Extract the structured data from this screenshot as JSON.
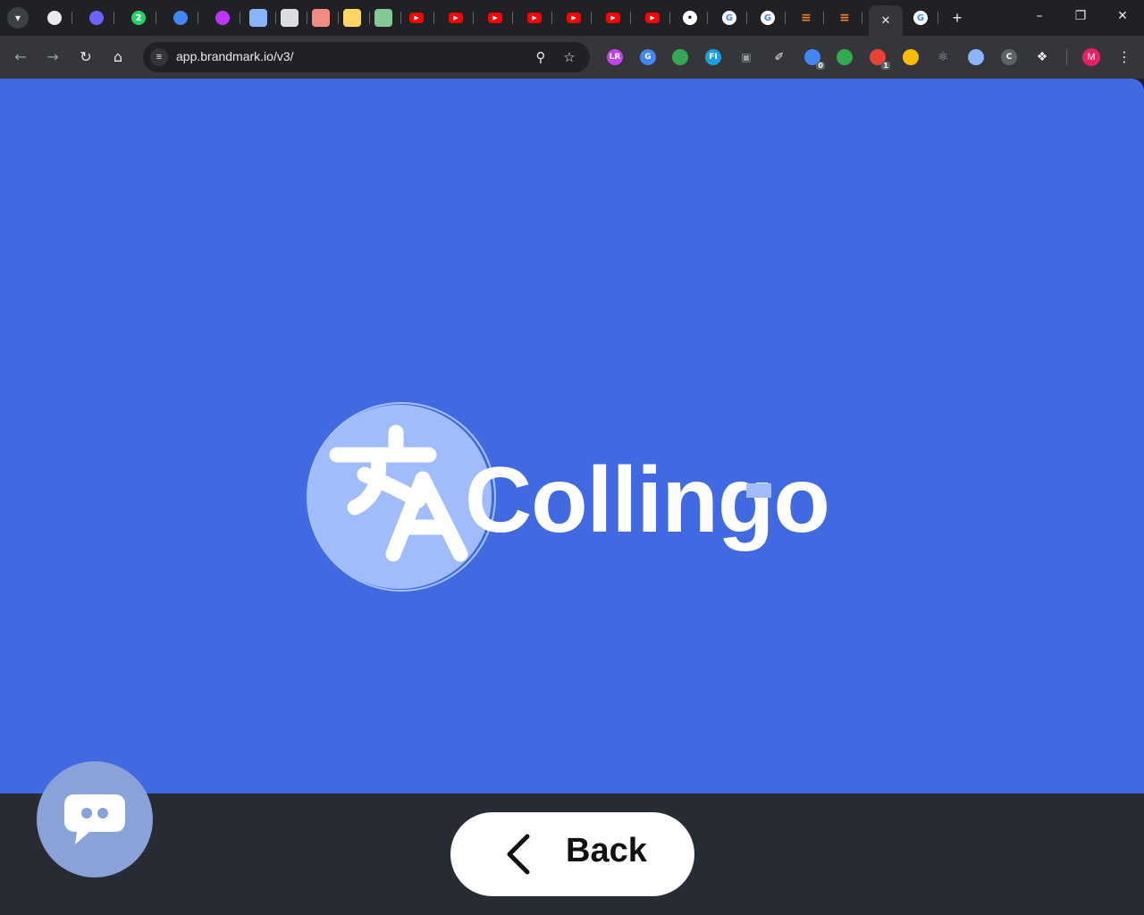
{
  "browser": {
    "tabs": [
      {
        "icon": "openai-icon",
        "color": "#e8eaed"
      },
      {
        "icon": "extension-tab-icon",
        "color": "#6c63ff"
      },
      {
        "icon": "whatsapp-icon",
        "color": "#25d366",
        "badge": "2"
      },
      {
        "icon": "google-translate-icon",
        "color": "#4285f4"
      },
      {
        "icon": "vite-icon",
        "color": "#bd34fe"
      },
      {
        "icon": "blue-square-icon",
        "color": "#8ab4f8"
      },
      {
        "icon": "gray-square-icon",
        "color": "#dadce0"
      },
      {
        "icon": "red-square-icon",
        "color": "#f28b82"
      },
      {
        "icon": "yellow-square-icon",
        "color": "#fdd663"
      },
      {
        "icon": "green-square-icon",
        "color": "#81c995"
      },
      {
        "icon": "youtube-icon",
        "color": "#ff0000"
      },
      {
        "icon": "youtube-icon",
        "color": "#ff0000"
      },
      {
        "icon": "youtube-icon",
        "color": "#ff0000"
      },
      {
        "icon": "youtube-icon",
        "color": "#ff0000"
      },
      {
        "icon": "youtube-icon",
        "color": "#ff0000"
      },
      {
        "icon": "youtube-icon",
        "color": "#ff0000"
      },
      {
        "icon": "youtube-icon",
        "color": "#ff0000"
      },
      {
        "icon": "github-icon",
        "color": "#ffffff"
      },
      {
        "icon": "google-icon",
        "color": "#ffffff"
      },
      {
        "icon": "google-icon",
        "color": "#ffffff"
      },
      {
        "icon": "stackoverflow-icon",
        "color": "#f48024"
      },
      {
        "icon": "stackoverflow-icon",
        "color": "#f48024"
      },
      {
        "icon": "close-icon",
        "color": "#e8eaed",
        "active": true
      },
      {
        "icon": "google-icon",
        "color": "#ffffff"
      }
    ],
    "address": {
      "url": "app.brandmark.io/v3/"
    },
    "extensions": [
      {
        "icon": "lr-extension-icon",
        "color": "#c042e8",
        "text": "LR"
      },
      {
        "icon": "translate-extension-icon",
        "color": "#4285f4",
        "text": "G"
      },
      {
        "icon": "color-extension-icon",
        "color": "#34a853",
        "text": ""
      },
      {
        "icon": "fi-extension-icon",
        "color": "#1a9fe0",
        "text": "FI"
      },
      {
        "icon": "camera-extension-icon",
        "color": "#9aa0a6",
        "text": ""
      },
      {
        "icon": "eyedropper-extension-icon",
        "color": "#e8eaed",
        "text": ""
      },
      {
        "icon": "gauge-extension-icon",
        "color": "#4285f4",
        "text": "",
        "badge": "0"
      },
      {
        "icon": "leaf-extension-icon",
        "color": "#34a853",
        "text": ""
      },
      {
        "icon": "red-extension-icon",
        "color": "#ea4335",
        "text": "",
        "badge": "1"
      },
      {
        "icon": "chrome-extension-icon",
        "color": "#fbbc04",
        "text": ""
      },
      {
        "icon": "react-extension-icon",
        "color": "#9aa0a6",
        "text": ""
      },
      {
        "icon": "ring-extension-icon",
        "color": "#8ab4f8",
        "text": ""
      },
      {
        "icon": "c-extension-icon",
        "color": "#5f6368",
        "text": "C"
      },
      {
        "icon": "puzzle-extensions-icon",
        "color": "#e8eaed",
        "text": ""
      }
    ],
    "profile_initial": "M"
  },
  "page": {
    "brand_name": "Collingo",
    "background_color": "#4169e1",
    "back_button_label": "Back"
  }
}
